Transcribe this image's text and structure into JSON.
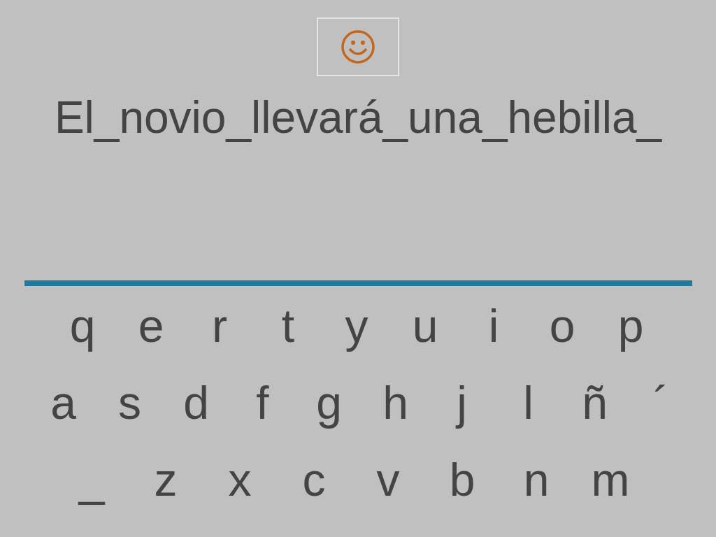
{
  "sentence": "El_novio_llevará_una_hebilla_",
  "keyboard": {
    "rows": [
      [
        "q",
        "e",
        "r",
        "t",
        "y",
        "u",
        "i",
        "o",
        "p"
      ],
      [
        "a",
        "s",
        "d",
        "f",
        "g",
        "h",
        "j",
        "l",
        "ñ",
        "´"
      ],
      [
        "_",
        "z",
        "x",
        "c",
        "v",
        "b",
        "n",
        "m"
      ]
    ]
  }
}
